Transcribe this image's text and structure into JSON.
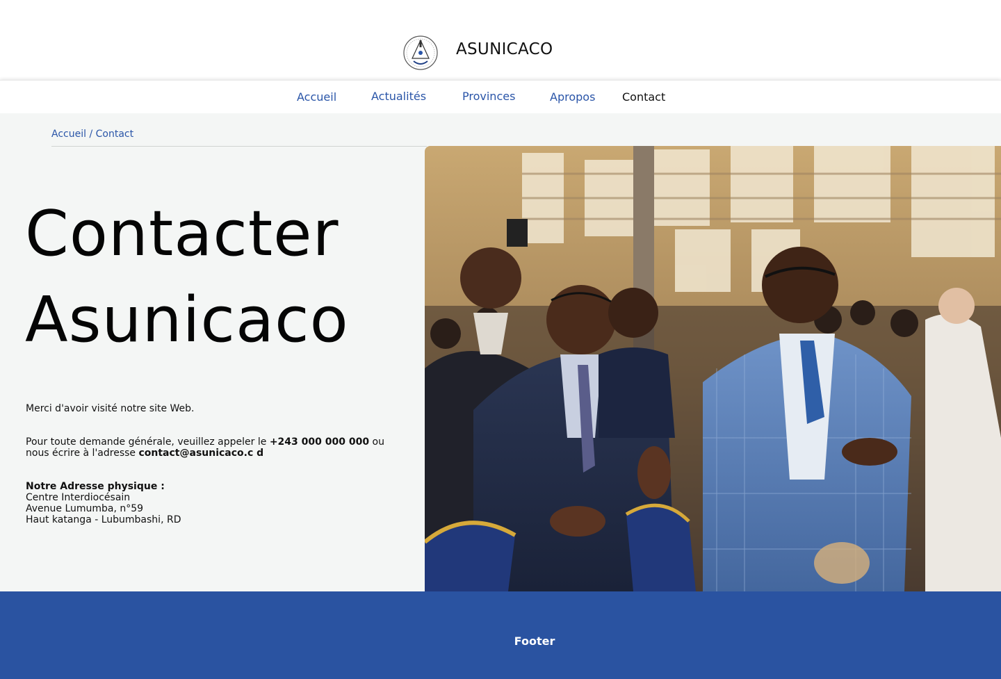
{
  "header": {
    "brand": "ASUNICACO",
    "logo_icon": "asunicaco-logo-icon"
  },
  "nav": {
    "items": [
      {
        "label": "Accueil",
        "active": false
      },
      {
        "label": "Actualités",
        "active": false
      },
      {
        "label": "Provinces",
        "active": false
      },
      {
        "label": "Apropos",
        "active": false
      },
      {
        "label": "Contact",
        "active": true
      }
    ]
  },
  "breadcrumb": {
    "home": "Accueil",
    "separator": " / ",
    "current": "Contact"
  },
  "main": {
    "title_line1": "Contacter",
    "title_line2": "Asunicaco",
    "thanks": "Merci d'avoir visité notre site Web.",
    "inquiry_prefix": "Pour toute demande générale, veuillez appeler le ",
    "phone": "+243 000 000 000",
    "inquiry_middle": " ou",
    "inquiry_line2_prefix": "nous écrire à l'adresse ",
    "email": "contact@asunicaco.c d",
    "address_label": "Notre Adresse physique :",
    "address_lines": [
      "Centre Interdiocésain",
      "Avenue Lumumba, n°59",
      "Haut katanga - Lubumbashi, RD"
    ]
  },
  "photo": {
    "subject": "congregation-worship-photo"
  },
  "footer": {
    "label": "Footer"
  },
  "colors": {
    "accent": "#2a55a8",
    "footer_bg": "#2a53a1",
    "content_bg": "#f4f6f5"
  }
}
